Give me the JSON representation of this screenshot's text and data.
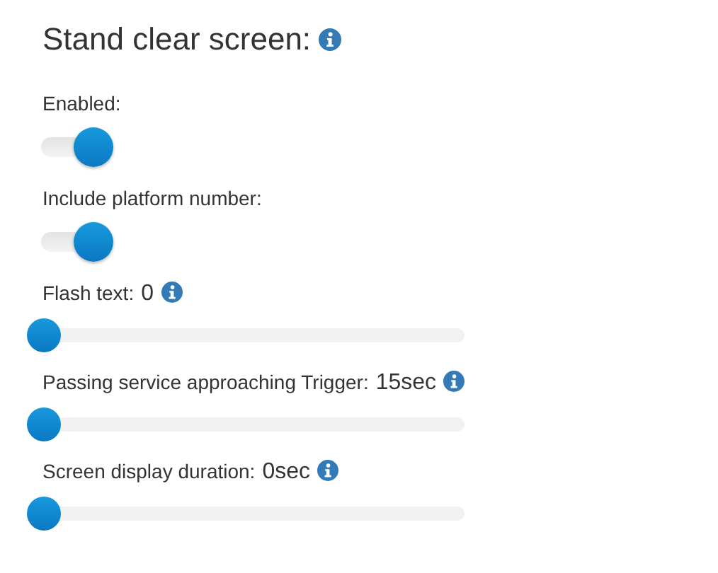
{
  "title": "Stand clear screen:",
  "settings": [
    {
      "kind": "toggle",
      "label": "Enabled:",
      "on": true
    },
    {
      "kind": "toggle",
      "label": "Include platform number:",
      "on": true
    },
    {
      "kind": "slider",
      "label": "Flash text:",
      "value": "0",
      "level": 0
    },
    {
      "kind": "slider",
      "label": "Passing service approaching Trigger:",
      "value": "15sec",
      "level": 0
    },
    {
      "kind": "slider",
      "label": "Screen display duration:",
      "value": "0sec",
      "level": 0
    }
  ]
}
